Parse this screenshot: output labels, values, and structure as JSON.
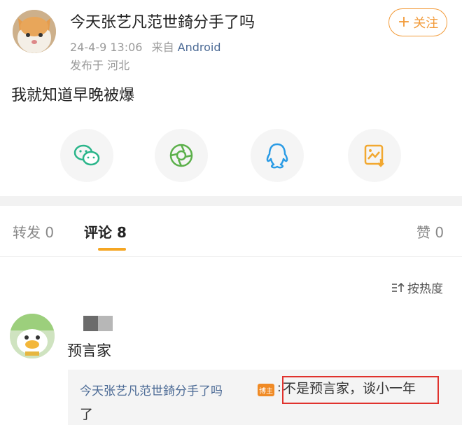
{
  "post": {
    "username": "今天张艺凡范世錡分手了吗",
    "time": "24-4-9 13:06",
    "source_prefix": "来自",
    "source": "Android",
    "location": "发布于 河北",
    "text": "我就知道早晚被爆",
    "follow_label": "关注"
  },
  "share": {
    "items": [
      {
        "icon": "wechat-icon",
        "color": "#2ab58a"
      },
      {
        "icon": "moments-icon",
        "color": "#5bb04a"
      },
      {
        "icon": "qq-icon",
        "color": "#2a9be5"
      },
      {
        "icon": "save-image-icon",
        "color": "#f2a830"
      }
    ]
  },
  "tabs": {
    "repost": "转发 0",
    "comment": "评论 8",
    "like": "赞 0"
  },
  "sort": {
    "label": "按热度"
  },
  "comment": {
    "text": "预言家",
    "reply_author": "今天张艺凡范世錡分手了吗",
    "badge": "博主",
    "colon": ":",
    "reply_text": "不是预言家，谈小一年",
    "reply_tail": "了"
  },
  "colors": {
    "accent": "#f5a623",
    "link": "#4b6a95",
    "highlight_box": "#e0322d"
  }
}
